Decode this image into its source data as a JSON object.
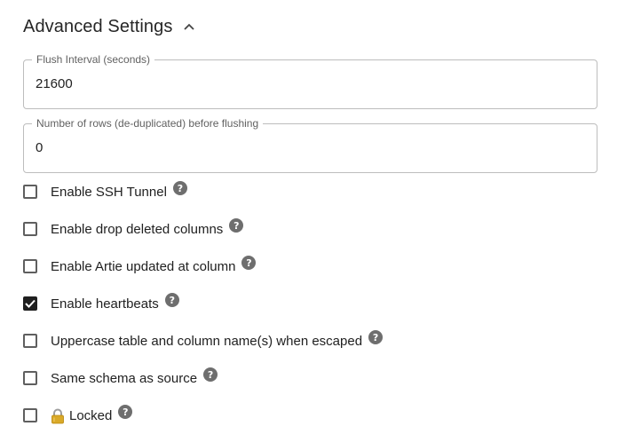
{
  "section": {
    "title": "Advanced Settings",
    "icon": "chevron-up-icon"
  },
  "fields": [
    {
      "label": "Flush Interval (seconds)",
      "value": "21600"
    },
    {
      "label": "Number of rows (de-duplicated) before flushing",
      "value": "0"
    }
  ],
  "checkboxes": [
    {
      "label": "Enable SSH Tunnel",
      "checked": false
    },
    {
      "label": "Enable drop deleted columns",
      "checked": false
    },
    {
      "label": "Enable Artie updated at column",
      "checked": false
    },
    {
      "label": "Enable heartbeats",
      "checked": true
    },
    {
      "label": "Uppercase table and column name(s) when escaped",
      "checked": false
    },
    {
      "label": "Same schema as source",
      "checked": false
    },
    {
      "label": "Locked",
      "checked": false,
      "icon": "lock-icon"
    }
  ],
  "help_icon": {
    "glyph": "?",
    "icon": "help-circle-icon"
  },
  "colors": {
    "border": "#bdbdbd",
    "checkbox_checked": "#1f1f1f",
    "help_icon": "#6e6e6e",
    "text": "#212121"
  }
}
